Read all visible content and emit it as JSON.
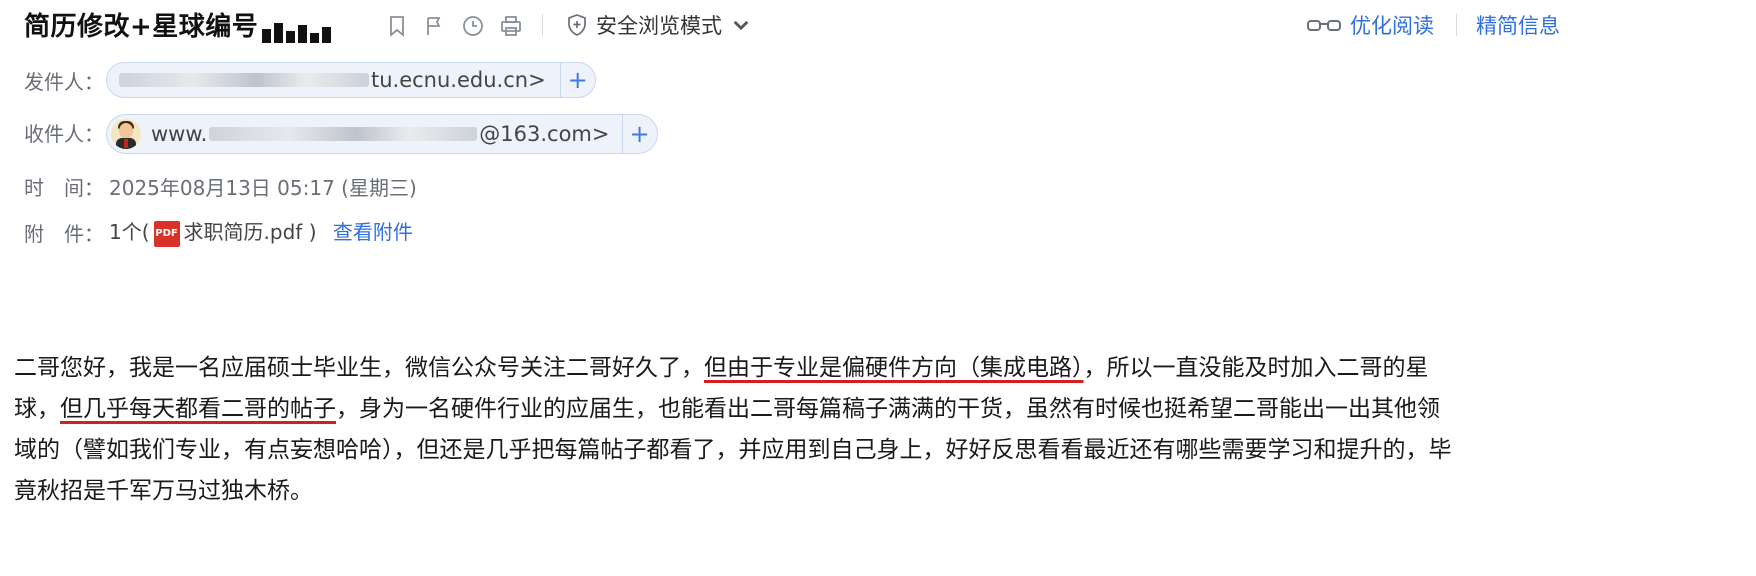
{
  "header": {
    "subject": "简历修改+星球编号",
    "safe_mode_label": "安全浏览模式",
    "reader_label": "优化阅读",
    "slim_label": "精简信息"
  },
  "meta": {
    "from_label": "发件人：",
    "from_value": "tu.ecnu.edu.cn>",
    "to_label": "收件人：",
    "to_prefix": "www.",
    "to_suffix": "@163.com>",
    "time_label": "时　间：",
    "time_value": "2025年08月13日 05:17 (星期三)",
    "attach_label": "附　件：",
    "attach_count": "1个(",
    "attach_file": "求职简历.pdf",
    "attach_close": ")",
    "attach_view": "查看附件",
    "plus": "+",
    "pdf_icon_text": "PDF"
  },
  "body": {
    "l1a": "二哥您好，我是一名应届硕士毕业生，微信公众号关注二哥好久了，",
    "l1b": "但由于专业是偏硬件方向（集成电路）",
    "l1c": "，所以一直没能及时加入二哥的星",
    "l2a": "球，",
    "l2b": "但几乎每天都看二哥的帖子",
    "l2c": "，身为一名硬件行业的应届生，也能看出二哥每篇稿子满满的干货，虽然有时候也挺希望二哥能出一出其他领",
    "l3": "域的（譬如我们专业，有点妄想哈哈），但还是几乎把每篇帖子都看了，并应用到自己身上，好好反思看看最近还有哪些需要学习和提升的，毕",
    "l4": "竟秋招是千军万马过独木桥。"
  },
  "colors": {
    "accent": "#2f6fe0",
    "underline": "#d11f24",
    "chip_bg": "#eef2fb"
  }
}
